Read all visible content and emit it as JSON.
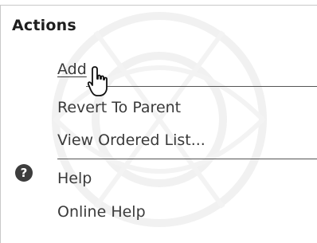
{
  "panel": {
    "title": "Actions"
  },
  "actions": {
    "add_label": "Add",
    "revert_label": "Revert To Parent",
    "view_list_label": "View Ordered List..."
  },
  "help": {
    "help_label": "Help",
    "online_help_label": "Online Help"
  },
  "icons": {
    "help": "question-circle-icon",
    "cursor": "hand-pointer-icon"
  },
  "colors": {
    "text": "#3a3a3a",
    "title": "#1e1e1e",
    "separator": "#555555"
  }
}
